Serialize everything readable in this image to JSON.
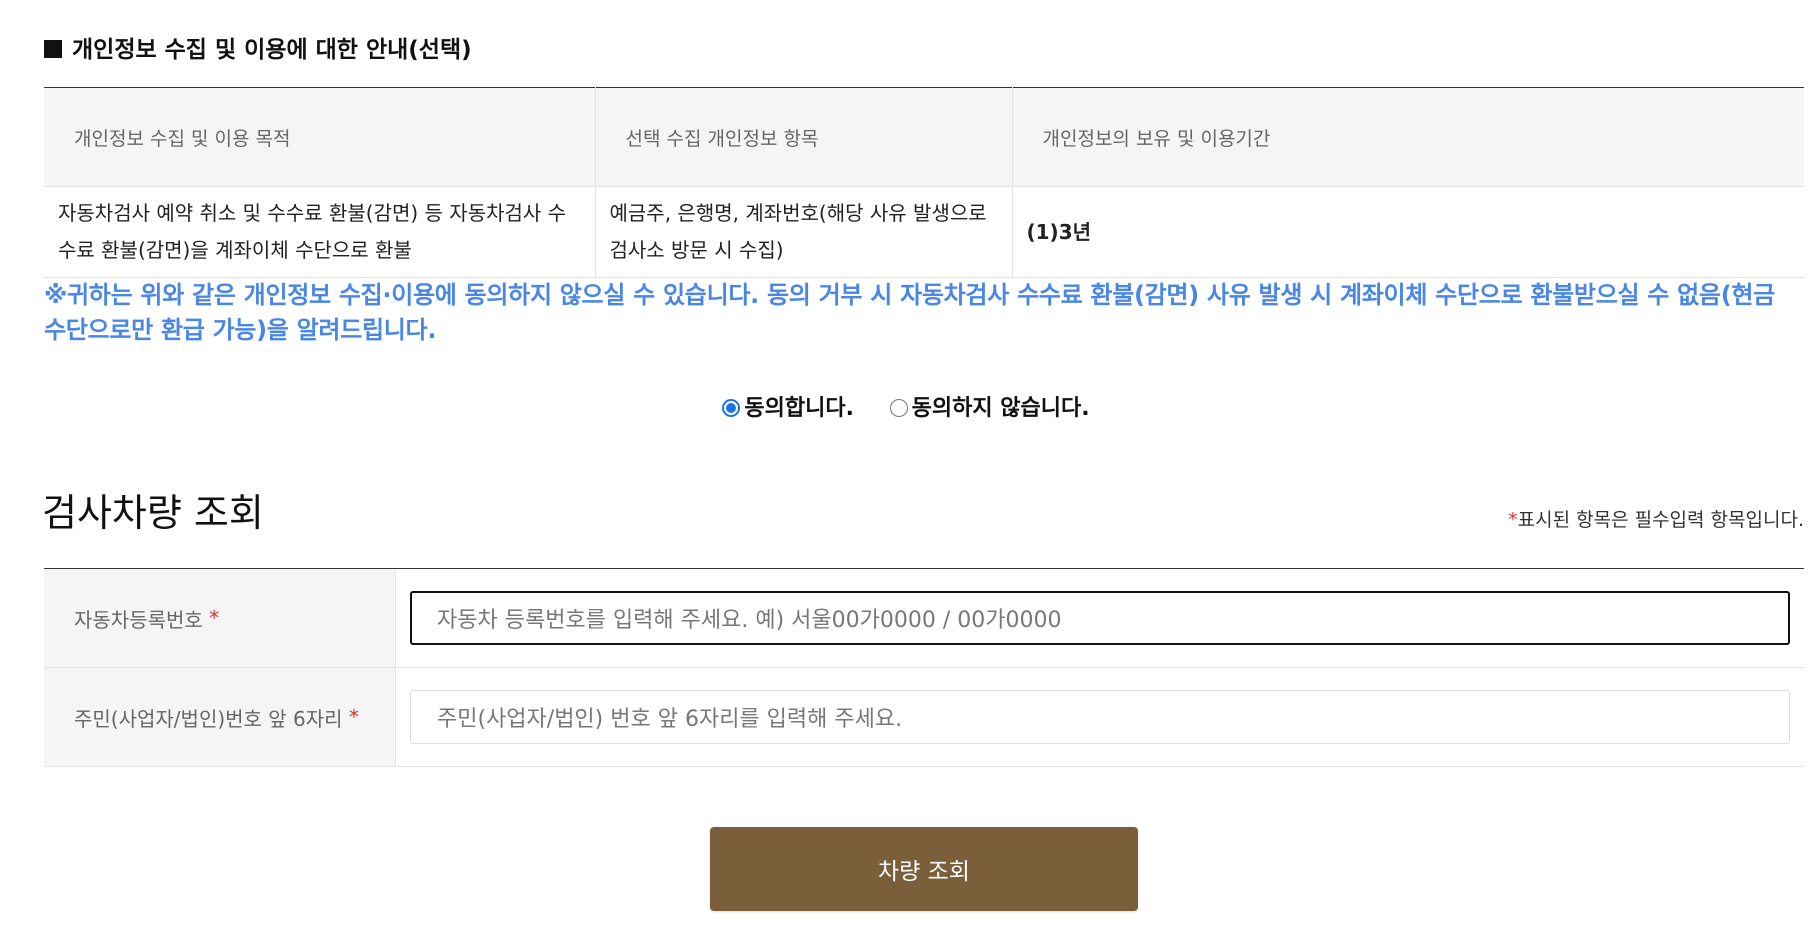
{
  "privacy_section": {
    "title": "개인정보 수집 및 이용에 대한 안내(선택)",
    "table": {
      "headers": [
        "개인정보 수집 및 이용 목적",
        "선택 수집 개인정보 항목",
        "개인정보의 보유 및 이용기간"
      ],
      "row": {
        "purpose": "자동차검사 예약 취소 및 수수료 환불(감면) 등 자동차검사 수수료 환불(감면)을 계좌이체 수단으로 환불",
        "items": "예금주, 은행명, 계좌번호(해당 사유 발생으로 검사소 방문 시 수집)",
        "period": "(1)3년"
      }
    },
    "notice": "※귀하는 위와 같은 개인정보 수집·이용에 동의하지 않으실 수 있습니다. 동의 거부 시 자동차검사 수수료 환불(감면) 사유 발생 시 계좌이체 수단으로 환불받으실 수 없음(현금 수단으로만 환급 가능)을 알려드립니다.",
    "consent": {
      "agree_label": "동의합니다.",
      "disagree_label": "동의하지 않습니다.",
      "selected": "agree"
    }
  },
  "vehicle_lookup": {
    "title": "검사차량 조회",
    "required_note": {
      "star": "*",
      "text": "표시된 항목은 필수입력 항목입니다."
    },
    "fields": {
      "registration": {
        "label": "자동차등록번호",
        "star": "*",
        "placeholder": "자동차 등록번호를 입력해 주세요. 예) 서울00가0000 / 00가0000"
      },
      "resident_number": {
        "label": "주민(사업자/법인)번호 앞 6자리",
        "star": "*",
        "placeholder": "주민(사업자/법인) 번호 앞 6자리를 입력해 주세요."
      }
    },
    "submit_label": "차량 조회"
  },
  "colors": {
    "accent_blue": "#4a86e8",
    "button_brown": "#7a5f3a",
    "required_red": "#d9362b"
  }
}
